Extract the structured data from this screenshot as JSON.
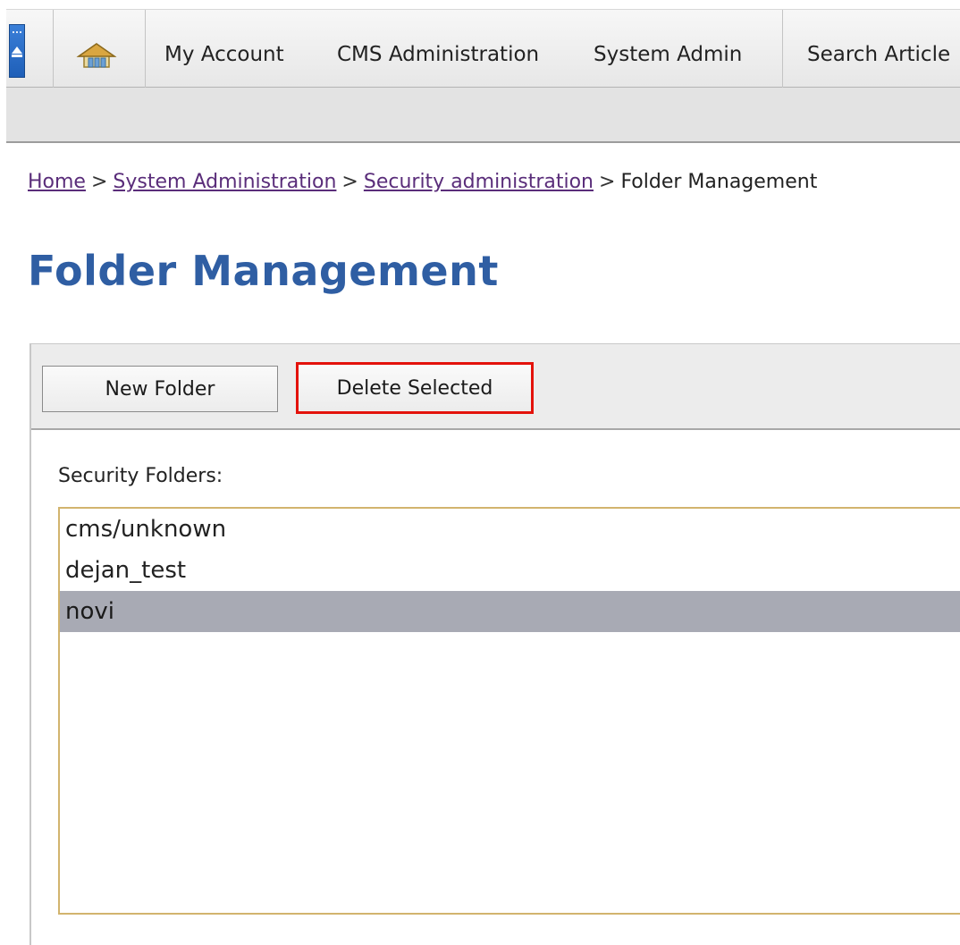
{
  "nav": {
    "items": [
      {
        "label": "My Account"
      },
      {
        "label": "CMS Administration"
      },
      {
        "label": "System Admin"
      },
      {
        "label": "Search Article"
      }
    ]
  },
  "breadcrumb": {
    "items": [
      {
        "label": "Home"
      },
      {
        "label": "System Administration"
      },
      {
        "label": "Security administration"
      }
    ],
    "separator": ">",
    "current": "Folder Management"
  },
  "page": {
    "title": "Folder Management"
  },
  "toolbar": {
    "new_folder_label": "New Folder",
    "delete_selected_label": "Delete Selected",
    "highlight_color": "#e3120b"
  },
  "folders": {
    "label": "Security Folders:",
    "items": [
      {
        "name": "cms/unknown",
        "selected": false
      },
      {
        "name": "dejan_test",
        "selected": false
      },
      {
        "name": "novi",
        "selected": true
      }
    ]
  },
  "colors": {
    "title": "#2f5ea3",
    "link": "#5a2d7a",
    "selection": "#a8aab4",
    "list_border": "#d2b46e"
  }
}
